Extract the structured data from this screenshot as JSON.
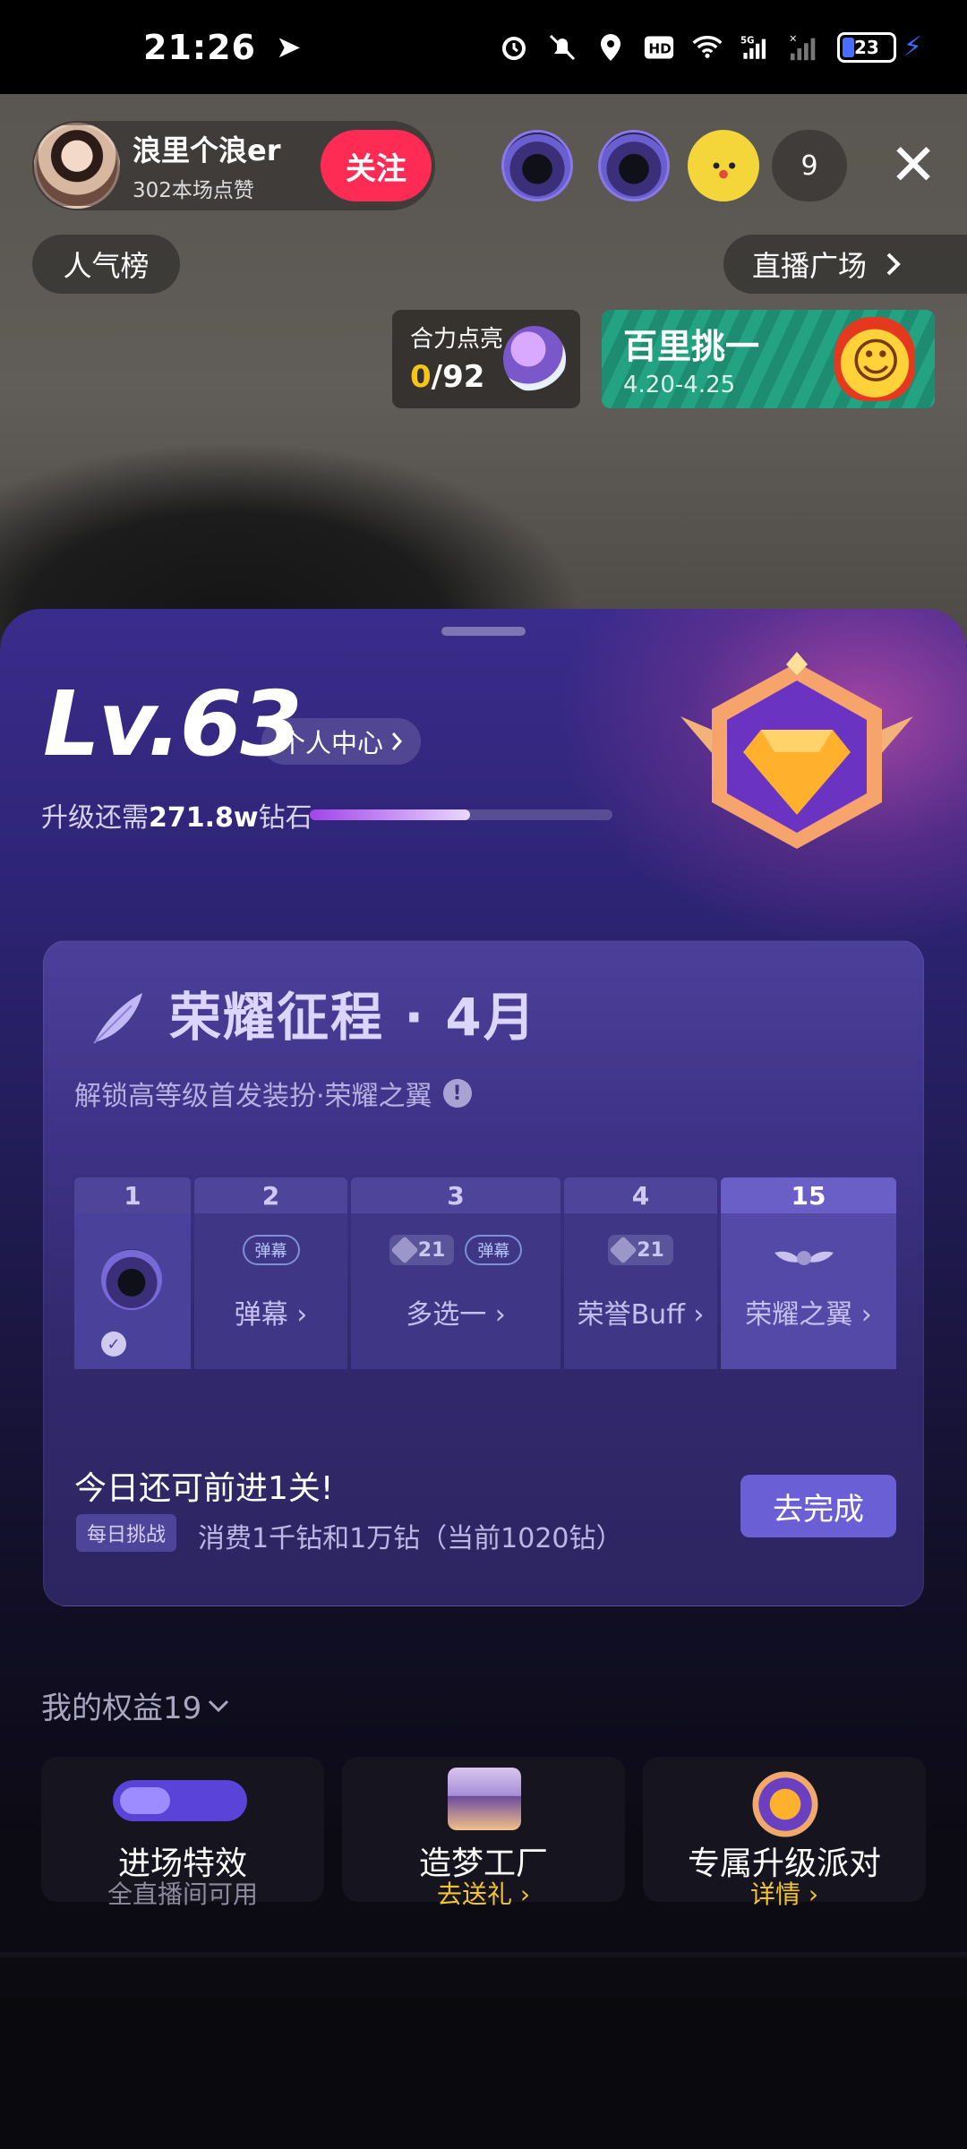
{
  "status_bar": {
    "time": "21:26",
    "battery": "23",
    "icons": [
      "navigation-icon",
      "alarm-icon",
      "mute-icon",
      "location-icon",
      "hd-icon",
      "wifi-icon",
      "5g-signal-icon",
      "signal-icon",
      "battery-icon",
      "charging-icon"
    ]
  },
  "streamer": {
    "name": "浪里个浪er",
    "likes": "302本场点赞",
    "follow_label": "关注"
  },
  "viewers": {
    "count": "9"
  },
  "top_pills": {
    "rank": "人气榜",
    "plaza": "直播广场"
  },
  "event_light": {
    "title": "合力点亮",
    "current": "0",
    "total": "/92"
  },
  "event_pk": {
    "title": "百里挑一",
    "date": "4.20-4.25"
  },
  "level": {
    "value": "Lv.63",
    "profile_label": "个人中心",
    "upgrade_prefix": "升级还需",
    "upgrade_amount": "271.8w",
    "upgrade_suffix": "钻石",
    "progress": 0.53
  },
  "glory": {
    "title": "荣耀征程 · 4月",
    "subtitle": "解锁高等级首发装扮·荣耀之翼",
    "levels": [
      {
        "num": "1",
        "label": ""
      },
      {
        "num": "2",
        "label": "弹幕 ›",
        "tags": [
          "弹幕"
        ]
      },
      {
        "num": "3",
        "label": "多选一 ›",
        "tags": [
          "21",
          "弹幕"
        ]
      },
      {
        "num": "4",
        "label": "荣誉Buff ›",
        "tags": [
          "21"
        ]
      },
      {
        "num": "15",
        "label": "荣耀之翼 ›"
      }
    ],
    "today": "今日还可前进1关!",
    "daily_tag": "每日挑战",
    "daily_desc": "消费1千钻和1万钻（当前1020钻）",
    "go_label": "去完成"
  },
  "rights": {
    "title": "我的权益19",
    "items": [
      {
        "title": "进场特效",
        "sub": "全直播间可用",
        "sub_color": "#8c8a9c"
      },
      {
        "title": "造梦工厂",
        "sub": "去送礼 ›",
        "sub_color": "#f4c430"
      },
      {
        "title": "专属升级派对",
        "sub": "详情 ›",
        "sub_color": "#f4c430"
      }
    ]
  },
  "colors": {
    "follow": "#fe2c55",
    "accent": "#6b5fd6",
    "gold": "#f4c430"
  }
}
